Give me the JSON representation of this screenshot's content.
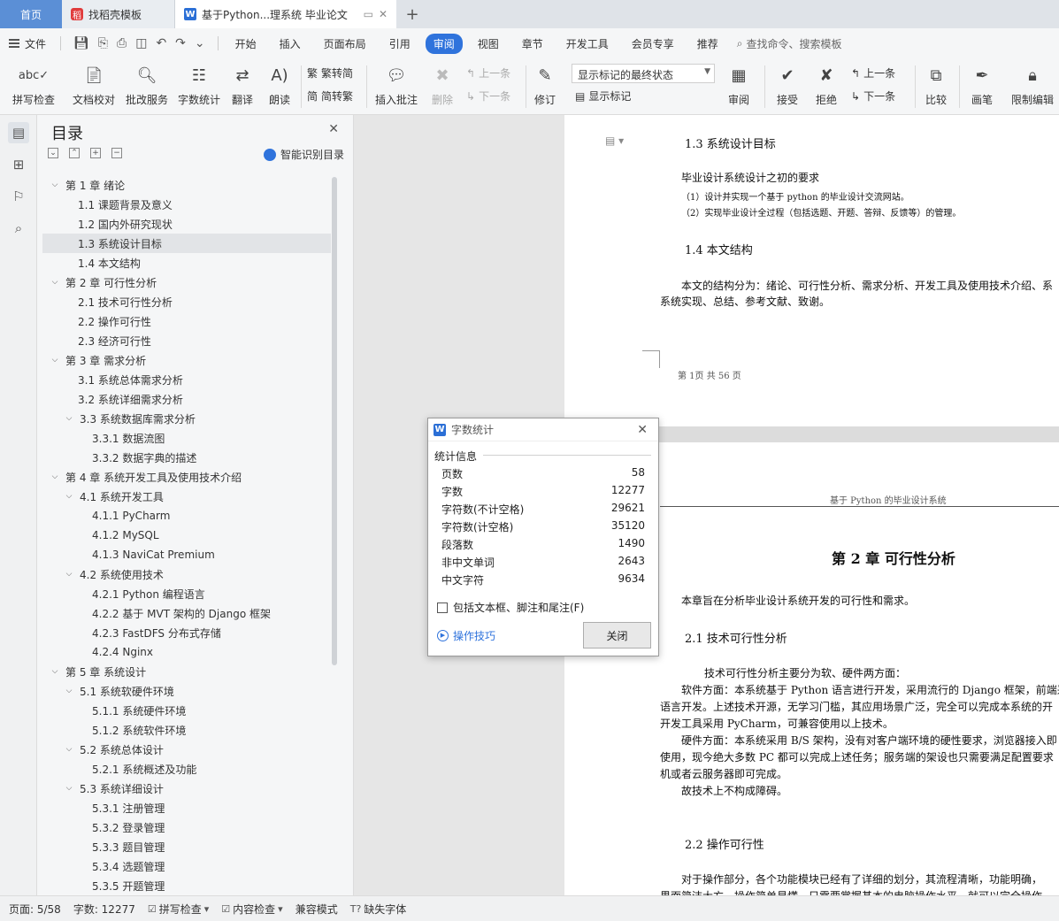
{
  "tabs": {
    "home": "首页",
    "templates": "找稻壳模板",
    "doc": "基于Python...理系统 毕业论文"
  },
  "menu": {
    "file": "文件",
    "items": [
      "开始",
      "插入",
      "页面布局",
      "引用",
      "审阅",
      "视图",
      "章节",
      "开发工具",
      "会员专享",
      "推荐"
    ],
    "search": "查找命令、搜索模板"
  },
  "ribbon": {
    "spellcheck": "拼写检查",
    "doccheck": "文档校对",
    "batch": "批改服务",
    "wordcount": "字数统计",
    "translate": "翻译",
    "read": "朗读",
    "to_simplified": "繁转简",
    "to_traditional": "简转繁",
    "insert_comment": "插入批注",
    "delete": "删除",
    "prev": "上一条",
    "next": "下一条",
    "revise": "修订",
    "markup_select": "显示标记的最终状态",
    "show_markup": "显示标记",
    "review": "审阅",
    "accept": "接受",
    "reject": "拒绝",
    "prev2": "上一条",
    "next2": "下一条",
    "compare": "比较",
    "ink": "画笔",
    "restrict": "限制编辑"
  },
  "toc": {
    "title": "目录",
    "smart": "智能识别目录",
    "items": [
      {
        "label": "第 1 章  绪论",
        "level": 1,
        "expanded": true
      },
      {
        "label": "1.1  课题背景及意义",
        "level": 2
      },
      {
        "label": "1.2  国内外研究现状",
        "level": 2
      },
      {
        "label": "1.3 系统设计目标",
        "level": 2,
        "selected": true
      },
      {
        "label": "1.4  本文结构",
        "level": 2
      },
      {
        "label": "第 2 章  可行性分析",
        "level": 1,
        "expanded": true
      },
      {
        "label": "2.1  技术可行性分析",
        "level": 2
      },
      {
        "label": "2.2  操作可行性",
        "level": 2
      },
      {
        "label": "2.3  经济可行性",
        "level": 2
      },
      {
        "label": "第 3 章  需求分析",
        "level": 1,
        "expanded": true
      },
      {
        "label": "3.1 系统总体需求分析",
        "level": 2
      },
      {
        "label": "3.2 系统详细需求分析",
        "level": 2
      },
      {
        "label": "3.3  系统数据库需求分析",
        "level": 2,
        "expanded": true
      },
      {
        "label": "3.3.1  数据流图",
        "level": 3
      },
      {
        "label": "3.3.2 数据字典的描述",
        "level": 3
      },
      {
        "label": "第 4 章  系统开发工具及使用技术介绍",
        "level": 1,
        "expanded": true
      },
      {
        "label": "4.1  系统开发工具",
        "level": 2,
        "expanded": true
      },
      {
        "label": "4.1.1 PyCharm",
        "level": 3
      },
      {
        "label": "4.1.2 MySQL",
        "level": 3
      },
      {
        "label": "4.1.3 NaviCat Premium",
        "level": 3
      },
      {
        "label": "4.2  系统使用技术",
        "level": 2,
        "expanded": true
      },
      {
        "label": "4.2.1 Python 编程语言",
        "level": 3
      },
      {
        "label": "4.2.2 基于 MVT 架构的 Django 框架",
        "level": 3
      },
      {
        "label": "4.2.3 FastDFS 分布式存储",
        "level": 3
      },
      {
        "label": "4.2.4 Nginx",
        "level": 3
      },
      {
        "label": "第 5 章  系统设计",
        "level": 1,
        "expanded": true
      },
      {
        "label": "5.1 系统软硬件环境",
        "level": 2,
        "expanded": true
      },
      {
        "label": "5.1.1  系统硬件环境",
        "level": 3
      },
      {
        "label": "5.1.2  系统软件环境",
        "level": 3
      },
      {
        "label": "5.2 系统总体设计",
        "level": 2,
        "expanded": true
      },
      {
        "label": "5.2.1 系统概述及功能",
        "level": 3
      },
      {
        "label": "5.3 系统详细设计",
        "level": 2,
        "expanded": true
      },
      {
        "label": "5.3.1  注册管理",
        "level": 3
      },
      {
        "label": "5.3.2  登录管理",
        "level": 3
      },
      {
        "label": "5.3.3  题目管理",
        "level": 3
      },
      {
        "label": "5.3.4  选题管理",
        "level": 3
      },
      {
        "label": "5.3.5  开题管理",
        "level": 3
      }
    ]
  },
  "page1": {
    "heading": "1.3 系统设计目标",
    "intro": "毕业设计系统设计之初的要求",
    "req1": "（1）设计并实现一个基于 python 的毕业设计交流网站。",
    "req2": "（2）实现毕业设计全过程（包括选题、开题、答辩、反馈等）的管理。",
    "heading2": "1.4  本文结构",
    "body1": "本文的结构分为：绪论、可行性分析、需求分析、开发工具及使用技术介绍、系",
    "body2": "系统实现、总结、参考文献、致谢。",
    "footer": "第 1页  共 56 页"
  },
  "page2": {
    "header": "基于 Python 的毕业设计系统",
    "chapter": "第 2 章  可行性分析",
    "intro": "本章旨在分析毕业设计系统开发的可行性和需求。",
    "sec1": "2.1  技术可行性分析",
    "lines": [
      "技术可行性分析主要分为软、硬件两方面：",
      "软件方面：本系统基于 Python 语言进行开发，采用流行的 Django 框架，前端采用",
      "语言开发。上述技术开源，无学习门槛，其应用场景广泛，完全可以完成本系统的开",
      "开发工具采用 PyCharm，可兼容使用以上技术。",
      "硬件方面：本系统采用 B/S 架构，没有对客户端环境的硬性要求，浏览器接入即",
      "使用，现今绝大多数 PC 都可以完成上述任务；服务端的架设也只需要满足配置要求",
      "机或者云服务器即可完成。",
      "故技术上不构成障碍。"
    ],
    "sec2": "2.2  操作可行性",
    "last1": "对于操作部分，各个功能模块已经有了详细的划分，其流程清晰，功能明确，",
    "last2": "界面简洁大方，操作简单易懂，只需要掌握基本的电脑操作水平，就可以完全操作"
  },
  "dialog": {
    "title": "字数统计",
    "section": "统计信息",
    "stats": [
      {
        "label": "页数",
        "value": "58"
      },
      {
        "label": "字数",
        "value": "12277"
      },
      {
        "label": "字符数(不计空格)",
        "value": "29621"
      },
      {
        "label": "字符数(计空格)",
        "value": "35120"
      },
      {
        "label": "段落数",
        "value": "1490"
      },
      {
        "label": "非中文单词",
        "value": "2643"
      },
      {
        "label": "中文字符",
        "value": "9634"
      }
    ],
    "checkbox": "包括文本框、脚注和尾注(F)",
    "tip": "操作技巧",
    "close": "关闭"
  },
  "status": {
    "page": "页面: 5/58",
    "words": "字数: 12277",
    "spell": "拼写检查",
    "content": "内容检查",
    "compat": "兼容模式",
    "missing_font": "缺失字体"
  },
  "colors": {
    "accent": "#2f73dc",
    "home_tab": "#5b8fd6"
  }
}
